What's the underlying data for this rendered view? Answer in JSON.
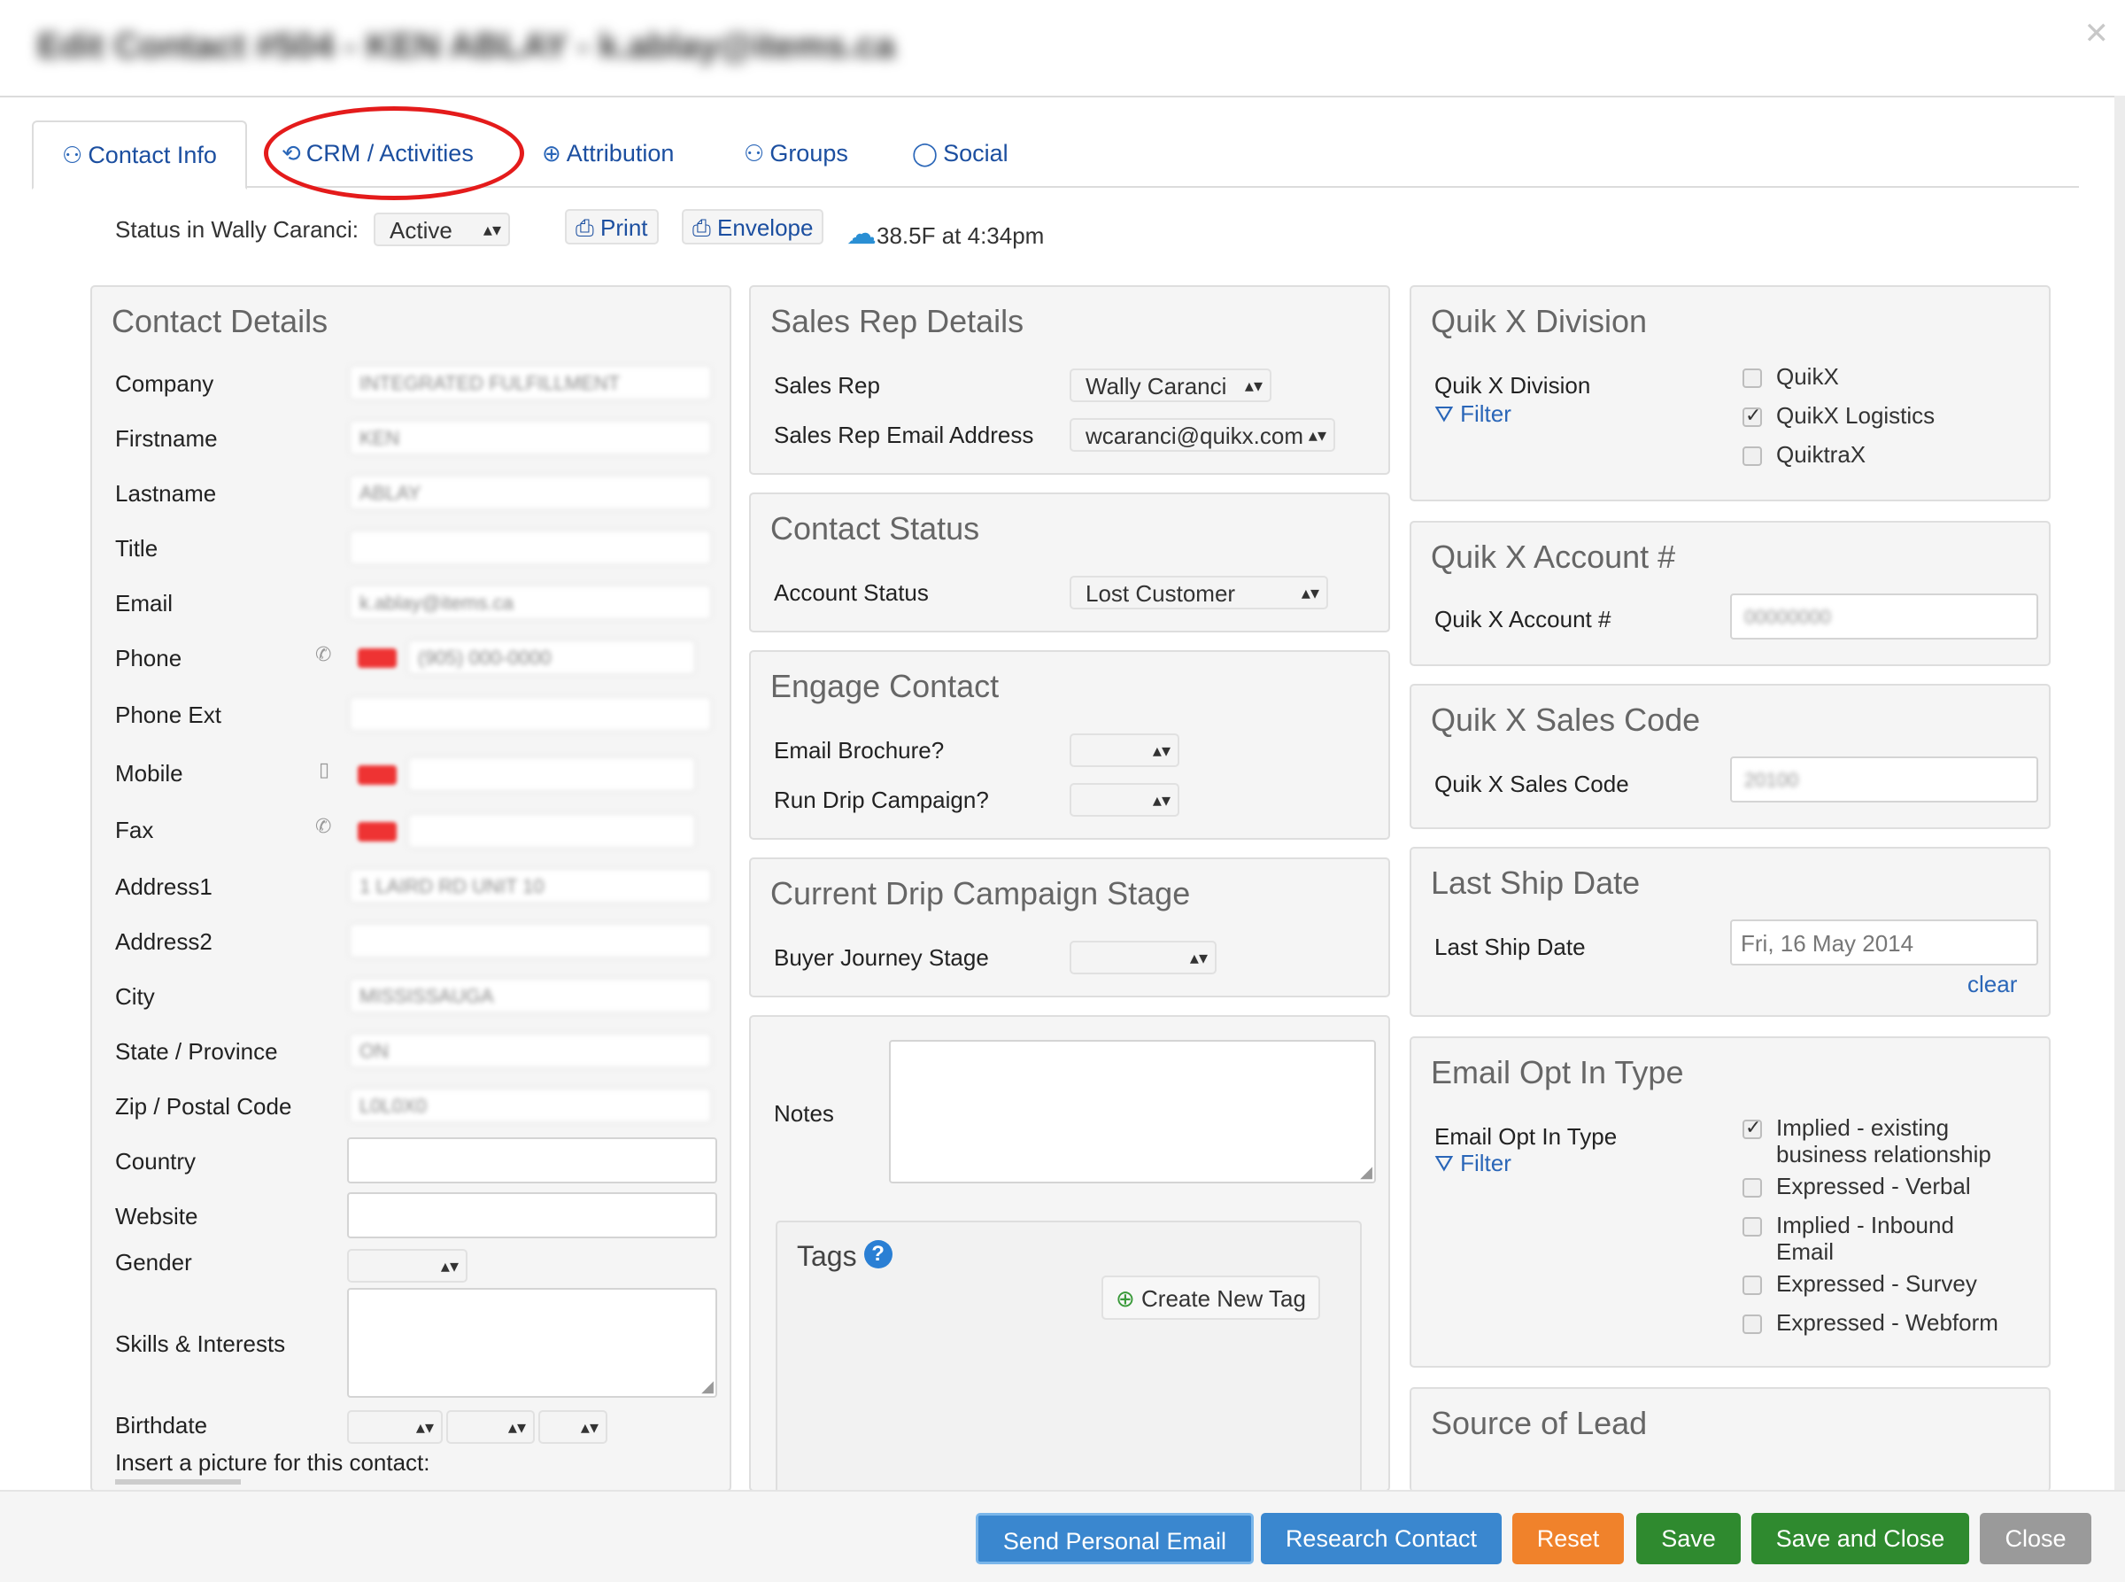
{
  "dialog": {
    "title": "Edit Contact #504 - KEN ABLAY - k.ablay@items.ca"
  },
  "tabs": [
    {
      "label": "Contact Info",
      "icon": "user-icon"
    },
    {
      "label": "CRM / Activities",
      "icon": "handshake-icon"
    },
    {
      "label": "Attribution",
      "icon": "globe-icon"
    },
    {
      "label": "Groups",
      "icon": "group-icon"
    },
    {
      "label": "Social",
      "icon": "speech-bubble-icon"
    }
  ],
  "status": {
    "label": "Status in Wally Caranci:",
    "value": "Active",
    "print": "Print",
    "envelope": "Envelope",
    "weather": "38.5F  at 4:34pm"
  },
  "contact_details": {
    "title": "Contact Details",
    "fields": {
      "company": {
        "label": "Company",
        "value": "INTEGRATED FULFILLMENT"
      },
      "firstname": {
        "label": "Firstname",
        "value": "KEN"
      },
      "lastname": {
        "label": "Lastname",
        "value": "ABLAY"
      },
      "title": {
        "label": "Title",
        "value": ""
      },
      "email": {
        "label": "Email",
        "value": "k.ablay@items.ca"
      },
      "phone": {
        "label": "Phone",
        "value": "(905) 000-0000"
      },
      "phone_ext": {
        "label": "Phone Ext",
        "value": ""
      },
      "mobile": {
        "label": "Mobile",
        "value": ""
      },
      "fax": {
        "label": "Fax",
        "value": ""
      },
      "address1": {
        "label": "Address1",
        "value": "1 LAIRD RD UNIT 10"
      },
      "address2": {
        "label": "Address2",
        "value": ""
      },
      "city": {
        "label": "City",
        "value": "MISSISSAUGA"
      },
      "state": {
        "label": "State / Province",
        "value": "ON"
      },
      "zip": {
        "label": "Zip / Postal Code",
        "value": "L0L0X0"
      },
      "country": {
        "label": "Country",
        "value": ""
      },
      "website": {
        "label": "Website",
        "value": ""
      },
      "gender": {
        "label": "Gender",
        "value": ""
      },
      "skills": {
        "label": "Skills & Interests",
        "value": ""
      },
      "birthdate": {
        "label": "Birthdate"
      }
    },
    "picture_label": "Insert a picture for this contact:"
  },
  "sales_rep": {
    "title": "Sales Rep Details",
    "rep_label": "Sales Rep",
    "rep_value": "Wally Caranci",
    "email_label": "Sales Rep Email Address",
    "email_value": "wcaranci@quikx.com"
  },
  "contact_status": {
    "title": "Contact Status",
    "label": "Account Status",
    "value": "Lost Customer"
  },
  "engage": {
    "title": "Engage Contact",
    "brochure_label": "Email Brochure?",
    "drip_label": "Run Drip Campaign?"
  },
  "drip_stage": {
    "title": "Current Drip Campaign Stage",
    "label": "Buyer Journey Stage"
  },
  "notes": {
    "label": "Notes"
  },
  "tags": {
    "title": "Tags",
    "help": "?",
    "create": "Create New Tag"
  },
  "division": {
    "title": "Quik X Division",
    "label": "Quik X Division",
    "filter": "Filter",
    "options": [
      {
        "label": "QuikX",
        "checked": false
      },
      {
        "label": "QuikX Logistics",
        "checked": true
      },
      {
        "label": "QuiktraX",
        "checked": false
      }
    ]
  },
  "account": {
    "title": "Quik X Account #",
    "label": "Quik X Account #",
    "value": "00000000"
  },
  "sales_code": {
    "title": "Quik X Sales Code",
    "label": "Quik X Sales Code",
    "value": "20100"
  },
  "ship_date": {
    "title": "Last Ship Date",
    "label": "Last Ship Date",
    "value": "Fri, 16 May 2014",
    "clear": "clear"
  },
  "opt_in": {
    "title": "Email Opt In Type",
    "label": "Email Opt In Type",
    "filter": "Filter",
    "options": [
      {
        "label": "Implied - existing business relationship",
        "checked": true
      },
      {
        "label": "Expressed - Verbal",
        "checked": false
      },
      {
        "label": "Implied - Inbound Email",
        "checked": false
      },
      {
        "label": "Expressed - Survey",
        "checked": false
      },
      {
        "label": "Expressed - Webform",
        "checked": false
      }
    ]
  },
  "lead_source": {
    "title": "Source of Lead"
  },
  "footer": {
    "send_email": "Send Personal Email",
    "research": "Research Contact",
    "reset": "Reset",
    "save": "Save",
    "save_close": "Save and Close",
    "close": "Close"
  },
  "colors": {
    "link_blue": "#1c4fa0",
    "btn_blue": "#3a87cf",
    "btn_orange": "#f0822b",
    "btn_green": "#2f8a2f",
    "btn_gray": "#9a9a9a",
    "highlight_red": "#e41b1b"
  }
}
